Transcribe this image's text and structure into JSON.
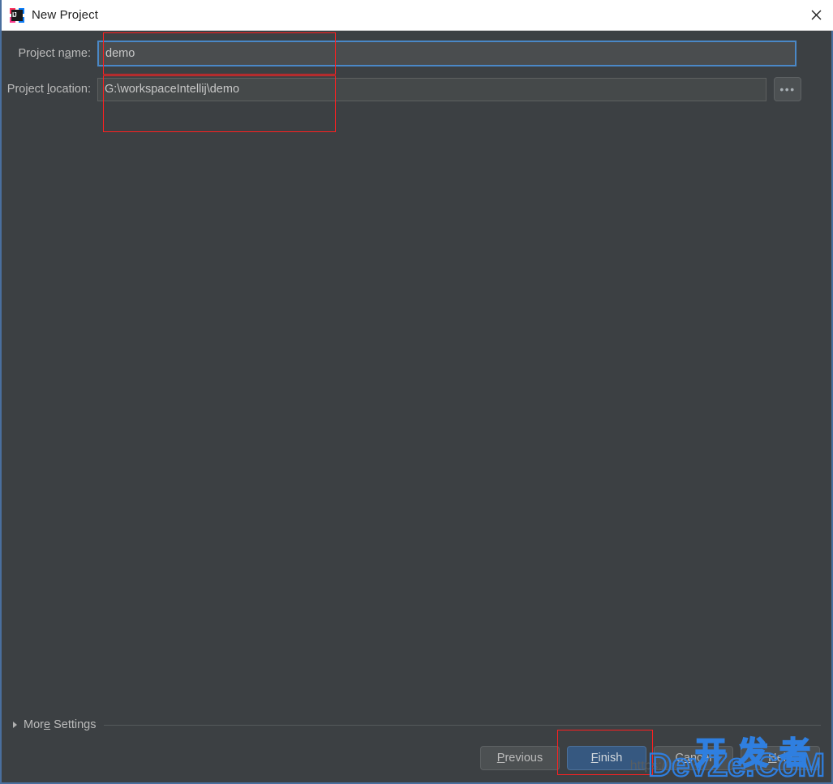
{
  "window": {
    "title": "New Project",
    "app_icon_name": "intellij-idea-icon",
    "close_label": "✕",
    "border_color": "#4a6f9e",
    "background_color": "#3c4043"
  },
  "form": {
    "project_name": {
      "label_before": "Project n",
      "label_mnemonic": "a",
      "label_after": "me:",
      "value": "demo",
      "placeholder": "",
      "focused": true,
      "focus_color": "#4a88c7"
    },
    "project_location": {
      "label_before": "Project ",
      "label_mnemonic": "l",
      "label_after": "ocation:",
      "value": "G:\\workspaceIntellij\\demo",
      "placeholder": "",
      "focused": false
    },
    "browse_button": {
      "label": "•••",
      "name": "browse-ellipsis-button"
    }
  },
  "more_settings": {
    "label_before": "Mor",
    "label_mnemonic": "e",
    "label_after": " Settings",
    "expanded": false
  },
  "buttons": [
    {
      "id": "previous",
      "label_before": "",
      "mnemonic": "P",
      "label_after": "revious",
      "primary": false
    },
    {
      "id": "finish",
      "label_before": "",
      "mnemonic": "F",
      "label_after": "inish",
      "primary": true
    },
    {
      "id": "cancel",
      "label_before": "C",
      "mnemonic": "a",
      "label_after": "ncel",
      "primary": false
    },
    {
      "id": "help",
      "label_before": "",
      "mnemonic": "H",
      "label_after": "elp",
      "primary": false
    }
  ],
  "annotations": [
    {
      "id": "annot-project-name",
      "color": "#ff2020"
    },
    {
      "id": "annot-project-location",
      "color": "#ff2020"
    },
    {
      "id": "annot-finish-button",
      "color": "#ff2020"
    }
  ],
  "watermark": {
    "chinese": "开发者",
    "latin": "DevZe.CoM",
    "url": "https://b...",
    "color": "#2f7fe0"
  }
}
